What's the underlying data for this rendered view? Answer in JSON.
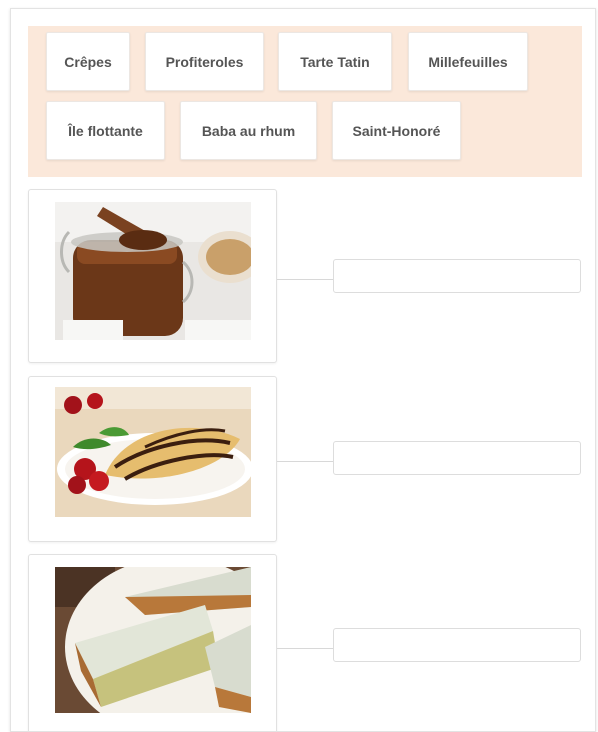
{
  "word_bank": {
    "items": [
      {
        "label": "Crêpes"
      },
      {
        "label": "Profiteroles"
      },
      {
        "label": "Tarte Tatin"
      },
      {
        "label": "Millefeuilles"
      },
      {
        "label": "Île flottante"
      },
      {
        "label": "Baba au rhum"
      },
      {
        "label": "Saint-Honoré"
      }
    ]
  },
  "matches": [
    {
      "image": "chocolate-spread-jar"
    },
    {
      "image": "crepes-with-chocolate"
    },
    {
      "image": "iced-cake-slices"
    }
  ],
  "colors": {
    "bank_background": "#fbe8da",
    "chip_text": "#555555",
    "border": "#dddddd"
  }
}
